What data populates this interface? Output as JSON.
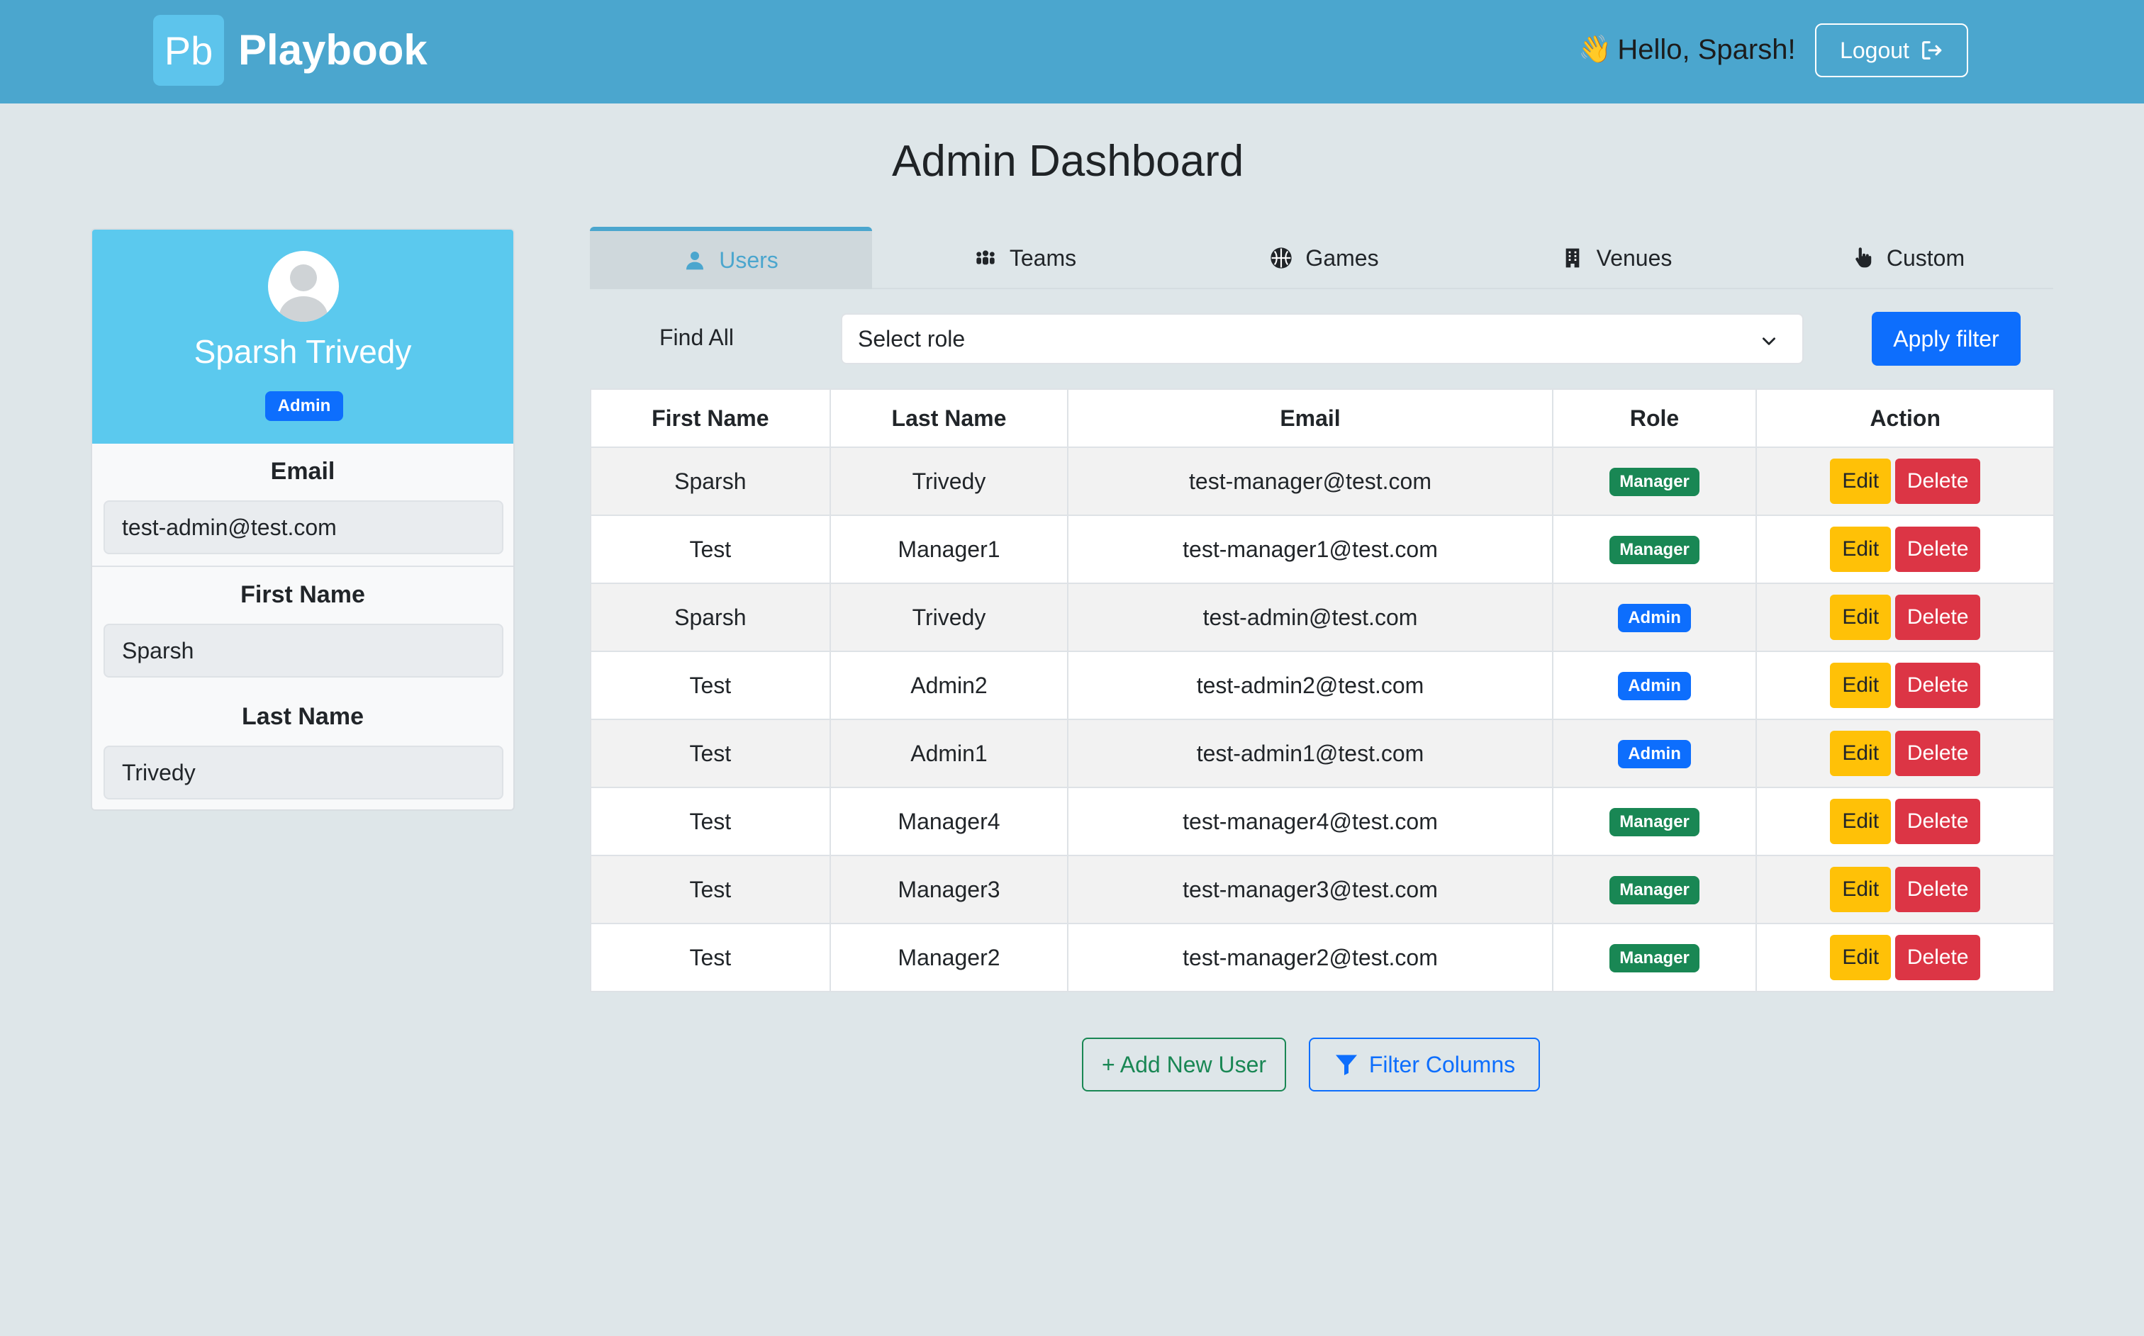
{
  "navbar": {
    "logo_text": "Pb",
    "brand": "Playbook",
    "greeting_icon": "👋",
    "greeting": "Hello, Sparsh!",
    "logout_label": "Logout"
  },
  "page_title": "Admin Dashboard",
  "profile": {
    "name": "Sparsh Trivedy",
    "role": "Admin",
    "email_label": "Email",
    "email": "test-admin@test.com",
    "first_name_label": "First Name",
    "first_name": "Sparsh",
    "last_name_label": "Last Name",
    "last_name": "Trivedy"
  },
  "tabs": [
    {
      "label": "Users",
      "icon": "user-icon",
      "active": true
    },
    {
      "label": "Teams",
      "icon": "people-icon",
      "active": false
    },
    {
      "label": "Games",
      "icon": "basketball-icon",
      "active": false
    },
    {
      "label": "Venues",
      "icon": "building-icon",
      "active": false
    },
    {
      "label": "Custom",
      "icon": "pointer-icon",
      "active": false
    }
  ],
  "filter": {
    "find_all_label": "Find All",
    "role_select_value": "Select role",
    "apply_label": "Apply filter"
  },
  "table": {
    "headers": [
      "First Name",
      "Last Name",
      "Email",
      "Role",
      "Action"
    ],
    "edit_label": "Edit",
    "delete_label": "Delete",
    "rows": [
      {
        "first": "Sparsh",
        "last": "Trivedy",
        "email": "test-manager@test.com",
        "role": "Manager"
      },
      {
        "first": "Test",
        "last": "Manager1",
        "email": "test-manager1@test.com",
        "role": "Manager"
      },
      {
        "first": "Sparsh",
        "last": "Trivedy",
        "email": "test-admin@test.com",
        "role": "Admin"
      },
      {
        "first": "Test",
        "last": "Admin2",
        "email": "test-admin2@test.com",
        "role": "Admin"
      },
      {
        "first": "Test",
        "last": "Admin1",
        "email": "test-admin1@test.com",
        "role": "Admin"
      },
      {
        "first": "Test",
        "last": "Manager4",
        "email": "test-manager4@test.com",
        "role": "Manager"
      },
      {
        "first": "Test",
        "last": "Manager3",
        "email": "test-manager3@test.com",
        "role": "Manager"
      },
      {
        "first": "Test",
        "last": "Manager2",
        "email": "test-manager2@test.com",
        "role": "Manager"
      }
    ]
  },
  "actions": {
    "add_user_label": "+ Add New User",
    "filter_columns_label": "Filter Columns"
  },
  "colors": {
    "navbar": "#4ba6ce",
    "profile_header": "#5bc9ee",
    "primary": "#0d6efd",
    "success": "#198754",
    "warning": "#ffc107",
    "danger": "#dc3545"
  }
}
